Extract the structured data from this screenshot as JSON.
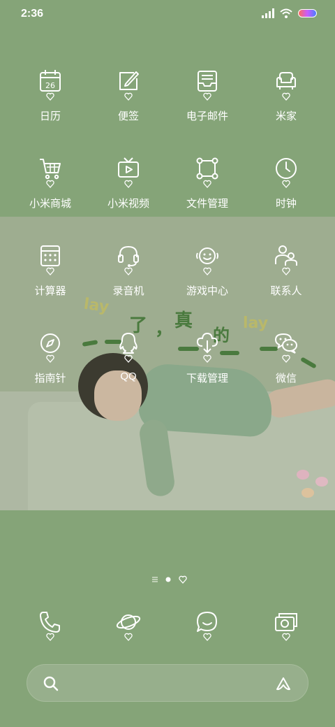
{
  "status_bar": {
    "time": "2:36"
  },
  "apps": [
    {
      "label": "日历",
      "icon": "calendar-icon",
      "date": "26"
    },
    {
      "label": "便签",
      "icon": "notes-icon"
    },
    {
      "label": "电子邮件",
      "icon": "email-icon"
    },
    {
      "label": "米家",
      "icon": "sofa-icon"
    },
    {
      "label": "小米商城",
      "icon": "shopping-cart-icon"
    },
    {
      "label": "小米视频",
      "icon": "tv-icon"
    },
    {
      "label": "文件管理",
      "icon": "file-manager-icon"
    },
    {
      "label": "时钟",
      "icon": "clock-icon"
    },
    {
      "label": "计算器",
      "icon": "calculator-icon"
    },
    {
      "label": "录音机",
      "icon": "recorder-icon"
    },
    {
      "label": "游戏中心",
      "icon": "game-center-icon"
    },
    {
      "label": "联系人",
      "icon": "contacts-icon"
    },
    {
      "label": "指南针",
      "icon": "compass-icon"
    },
    {
      "label": "QQ",
      "icon": "qq-icon"
    },
    {
      "label": "下载管理",
      "icon": "download-icon"
    },
    {
      "label": "微信",
      "icon": "wechat-icon"
    }
  ],
  "wallpaper_text": [
    "lay",
    "了",
    "，",
    "真",
    "的",
    "lay"
  ],
  "dock": [
    {
      "icon": "phone-icon"
    },
    {
      "icon": "browser-icon"
    },
    {
      "icon": "messages-icon"
    },
    {
      "icon": "camera-icon"
    }
  ],
  "page_indicator": {
    "pages": 3,
    "active": 1
  },
  "colors": {
    "background": "#85a478",
    "icon_stroke": "#ffffff",
    "search_bar": "#97af8c"
  }
}
